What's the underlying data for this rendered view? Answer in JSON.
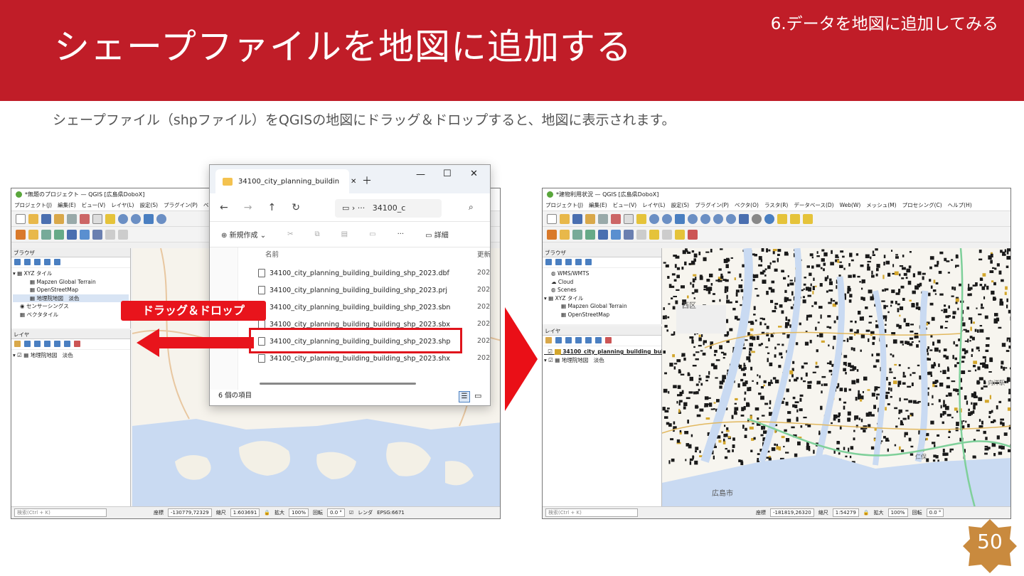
{
  "slide": {
    "title": "シェープファイルを地図に追加する",
    "section": "6.データを地図に追加してみる",
    "description": "シェープファイル（shpファイル）をQGISの地図にドラッグ＆ドロップすると、地図に表示されます。",
    "callout": "ドラッグ＆ドロップ",
    "page_number": "50"
  },
  "colors": {
    "accent": "#c01d28",
    "callout": "#e8141c",
    "badge": "#c98a3e"
  },
  "qgis_left": {
    "title": "*無題のプロジェクト — QGIS [広島県DoboX]",
    "menu": [
      "プロジェクト(J)",
      "編集(E)",
      "ビュー(V)",
      "レイヤ(L)",
      "設定(S)",
      "プラグイン(P)",
      "ベクタ(O)"
    ],
    "browser_title": "ブラウザ",
    "browser_items": [
      "XYZ タイル",
      "Mapzen Global Terrain",
      "OpenStreetMap",
      "地理院地図　淡色",
      "センサーシングス",
      "ベクタタイル"
    ],
    "layers_title": "レイヤ",
    "layers": [
      "地理院地図　淡色"
    ],
    "search_placeholder": "検索(Ctrl + K)",
    "coord_label": "座標",
    "coord_value": "-130779,72329",
    "scale_label": "縮尺",
    "scale_value": "1:603691",
    "zoom_label": "拡大",
    "zoom_value": "100%",
    "rotation_label": "回転",
    "rotation_value": "0.0 °",
    "render_label": "レンダ",
    "crs": "EPSG:6671"
  },
  "explorer": {
    "tab_title": "34100_city_planning_buildin",
    "address": "34100_c",
    "new_label": "新規作成",
    "details_label": "詳細",
    "column_name": "名前",
    "column_updated": "更新",
    "files": [
      "34100_city_planning_building_building_shp_2023.dbf",
      "34100_city_planning_building_building_shp_2023.prj",
      "34100_city_planning_building_building_shp_2023.sbn",
      "34100_city_planning_building_building_shp_2023.sbx",
      "34100_city_planning_building_building_shp_2023.shp",
      "34100_city_planning_building_building_shp_2023.shx"
    ],
    "date_prefix": "202",
    "status": "6 個の項目"
  },
  "qgis_right": {
    "title": "*建物利用状況 — QGIS [広島県DoboX]",
    "menu": [
      "プロジェクト(J)",
      "編集(E)",
      "ビュー(V)",
      "レイヤ(L)",
      "設定(S)",
      "プラグイン(P)",
      "ベクタ(O)",
      "ラスタ(R)",
      "データベース(D)",
      "Web(W)",
      "メッシュ(M)",
      "プロセシング(C)",
      "ヘルプ(H)"
    ],
    "browser_title": "ブラウザ",
    "browser_items": [
      "WMS/WMTS",
      "Cloud",
      "Scenes",
      "XYZ タイル",
      "Mapzen Global Terrain",
      "OpenStreetMap"
    ],
    "layers_title": "レイヤ",
    "layers": [
      "34100_city_planning_building_buil",
      "地理院地図　淡色"
    ],
    "search_placeholder": "検索(Ctrl + K)",
    "coord_label": "座標",
    "coord_value": "-181819,26320",
    "scale_label": "縮尺",
    "scale_value": "1:54279",
    "zoom_label": "拡大",
    "zoom_value": "100%",
    "rotation_label": "回転",
    "rotation_value": "0.0 °",
    "map_labels": [
      "西区",
      "広島市",
      "向洋駅",
      "仁保"
    ]
  }
}
